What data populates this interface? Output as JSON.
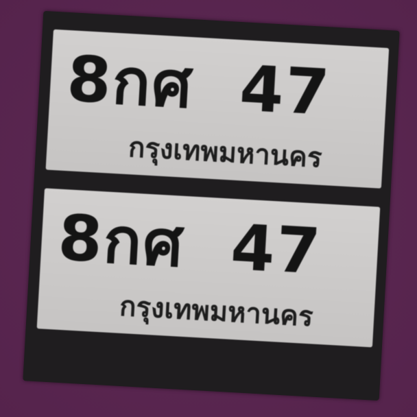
{
  "plates": [
    {
      "number": "8กศ  47",
      "province": "กรุงเทพมหานคร"
    },
    {
      "number": "8กศ  47",
      "province": "กรุงเทพมหานคร"
    }
  ]
}
